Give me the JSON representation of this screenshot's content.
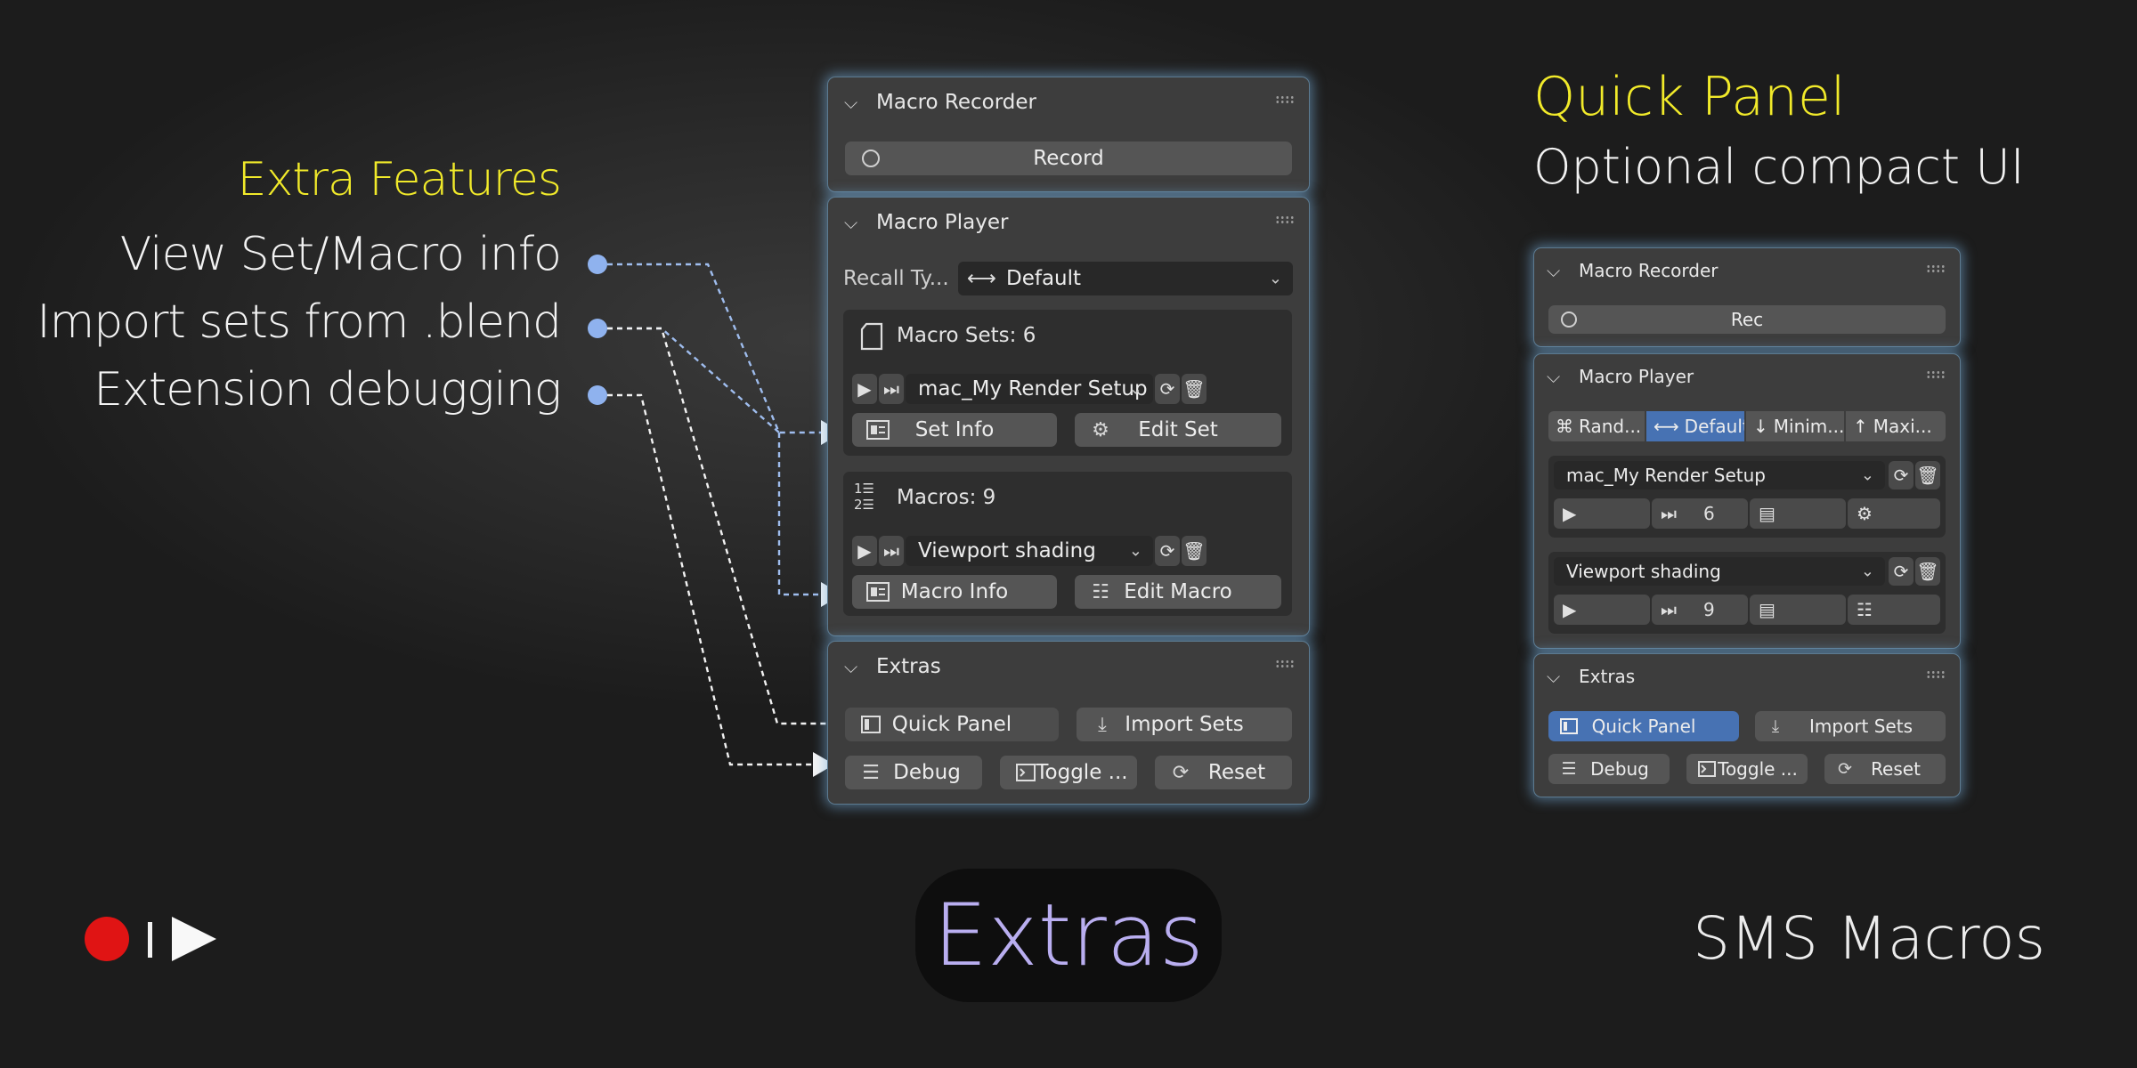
{
  "left": {
    "title": "Extra Features",
    "items": [
      "View Set/Macro info",
      "Import sets from .blend",
      "Extension debugging"
    ]
  },
  "quick": {
    "title": "Quick Panel",
    "subtitle": "Optional compact UI"
  },
  "main_panel": {
    "recorder": {
      "title": "Macro Recorder",
      "record_label": "Record"
    },
    "player": {
      "title": "Macro Player",
      "recall_label": "Recall Ty...",
      "recall_value": "Default",
      "sets_label": "Macro Sets: 6",
      "set_value": "mac_My Render Setup",
      "set_info_label": "Set Info",
      "edit_set_label": "Edit Set",
      "macros_label": "Macros: 9",
      "macro_value": "Viewport shading",
      "macro_info_label": "Macro Info",
      "edit_macro_label": "Edit Macro"
    },
    "extras": {
      "title": "Extras",
      "quick_panel_label": "Quick Panel",
      "import_sets_label": "Import Sets",
      "debug_label": "Debug",
      "toggle_label": "Toggle ...",
      "reset_label": "Reset"
    }
  },
  "compact_panel": {
    "recorder": {
      "title": "Macro Recorder",
      "rec_label": "Rec"
    },
    "player": {
      "title": "Macro Player",
      "modes": [
        "Rand...",
        "Default",
        "Minim...",
        "Maxi..."
      ],
      "active_mode": "Default",
      "set_value": "mac_My Render Setup",
      "set_count": "6",
      "macro_value": "Viewport shading",
      "macro_count": "9"
    },
    "extras": {
      "title": "Extras",
      "quick_panel_label": "Quick Panel",
      "import_sets_label": "Import Sets",
      "debug_label": "Debug",
      "toggle_label": "Toggle ...",
      "reset_label": "Reset"
    }
  },
  "badge": "Extras",
  "brand": "SMS Macros",
  "colors": {
    "accent_yellow": "#f1ea2a",
    "active_blue": "#4772b3",
    "connector_blue": "#8fb2ee",
    "pill_text": "#b9aef0"
  }
}
